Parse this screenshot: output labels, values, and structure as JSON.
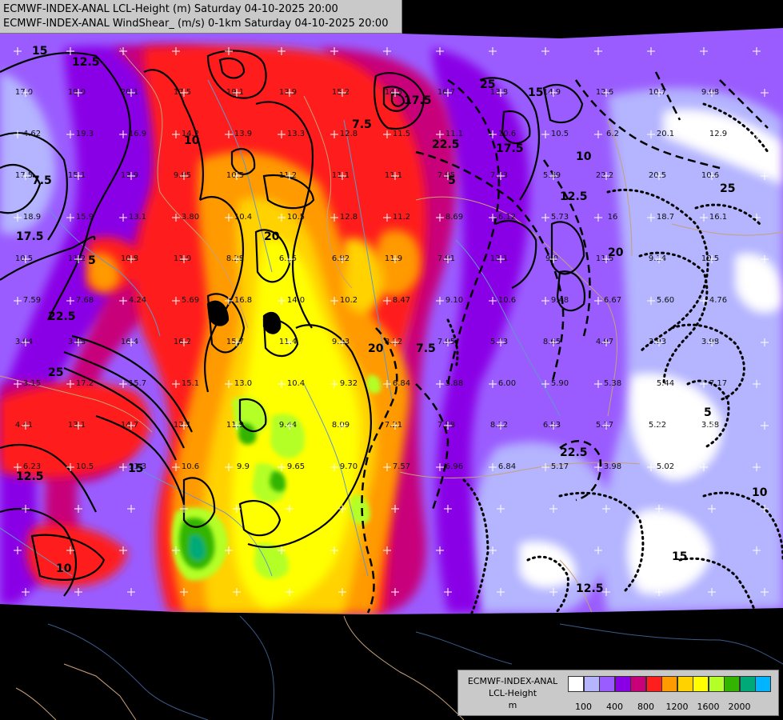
{
  "title": {
    "line1": "ECMWF-INDEX-ANAL LCL-Height (m) Saturday 04-10-2025 20:00",
    "line2": "ECMWF-INDEX-ANAL WindShear_ (m/s) 0-1km Saturday 04-10-2025 20:00"
  },
  "legend": {
    "line1": "ECMWF-INDEX-ANAL",
    "line2": "LCL-Height",
    "line3": "m",
    "colors": [
      "#ffffff",
      "#b4b4ff",
      "#9a5cff",
      "#8a00e6",
      "#c8007a",
      "#ff1e1e",
      "#ff9a00",
      "#ffd200",
      "#ffff00",
      "#b4ff28",
      "#32b400",
      "#00aa78",
      "#00b4ff"
    ],
    "tick_labels": [
      "100",
      "400",
      "800",
      "1200",
      "1600",
      "2000"
    ]
  },
  "map_colors": {
    "background": "#000000",
    "ocean_border": "#c8a078",
    "river": "#6496c8"
  },
  "contour_labels": [
    "15",
    "12.5",
    "10",
    "20",
    "7.5",
    "17.5",
    "22.5",
    "5",
    "25"
  ],
  "station_values": [
    "17.0",
    "19.0",
    "20.1",
    "17.5",
    "19.1",
    "13.9",
    "15.2",
    "14.5",
    "16.7",
    "13.8",
    "14.9",
    "12.6",
    "10.7",
    "9.08",
    "4.62",
    "19.3",
    "16.9",
    "14.2",
    "13.9",
    "13.3",
    "12.8",
    "11.5",
    "11.1",
    "10.6",
    "10.5",
    "6.2",
    "20.1",
    "12.9",
    "17.5",
    "15.1",
    "13.9",
    "9.85",
    "10.5",
    "11.2",
    "11.1",
    "11.1",
    "7.95",
    "7.23",
    "5.79",
    "22.2",
    "20.5",
    "10.6",
    "18.9",
    "15.9",
    "13.1",
    "3.80",
    "10.4",
    "10.5",
    "12.8",
    "11.2",
    "8.69",
    "6.12",
    "5.73",
    "16",
    "18.7",
    "16.1",
    "10.5",
    "11.2",
    "10.8",
    "11.0",
    "8.28",
    "6.15",
    "6.82",
    "11.9",
    "7.91",
    "12.1",
    "9.0",
    "11.6",
    "9.14",
    "10.5",
    "7.59",
    "7.68",
    "4.24",
    "5.69",
    "16.8",
    "14.0",
    "10.2",
    "8.47",
    "9.10",
    "10.6",
    "9.48",
    "6.67",
    "5.60",
    "4.76",
    "3.04",
    "3.88",
    "16.4",
    "16.2",
    "15.7",
    "11.4",
    "9.13",
    "8.12",
    "7.95",
    "5.73",
    "8.65",
    "4.97",
    "3.93",
    "3.98",
    "3.15",
    "17.2",
    "15.7",
    "15.1",
    "13.0",
    "10.4",
    "9.32",
    "6.84",
    "5.88",
    "6.00",
    "5.90",
    "5.38",
    "5.44",
    "7.17",
    "4.41",
    "13.1",
    "14.7",
    "12.1",
    "11.9",
    "9.44",
    "8.09",
    "7.21",
    "7.58",
    "8.12",
    "6.53",
    "5.17",
    "5.22",
    "3.58",
    "6.23",
    "10.5",
    "11.3",
    "10.6",
    "9.9",
    "9.65",
    "9.70",
    "7.57",
    "6.96",
    "6.84",
    "5.17",
    "3.98",
    "5.02"
  ]
}
